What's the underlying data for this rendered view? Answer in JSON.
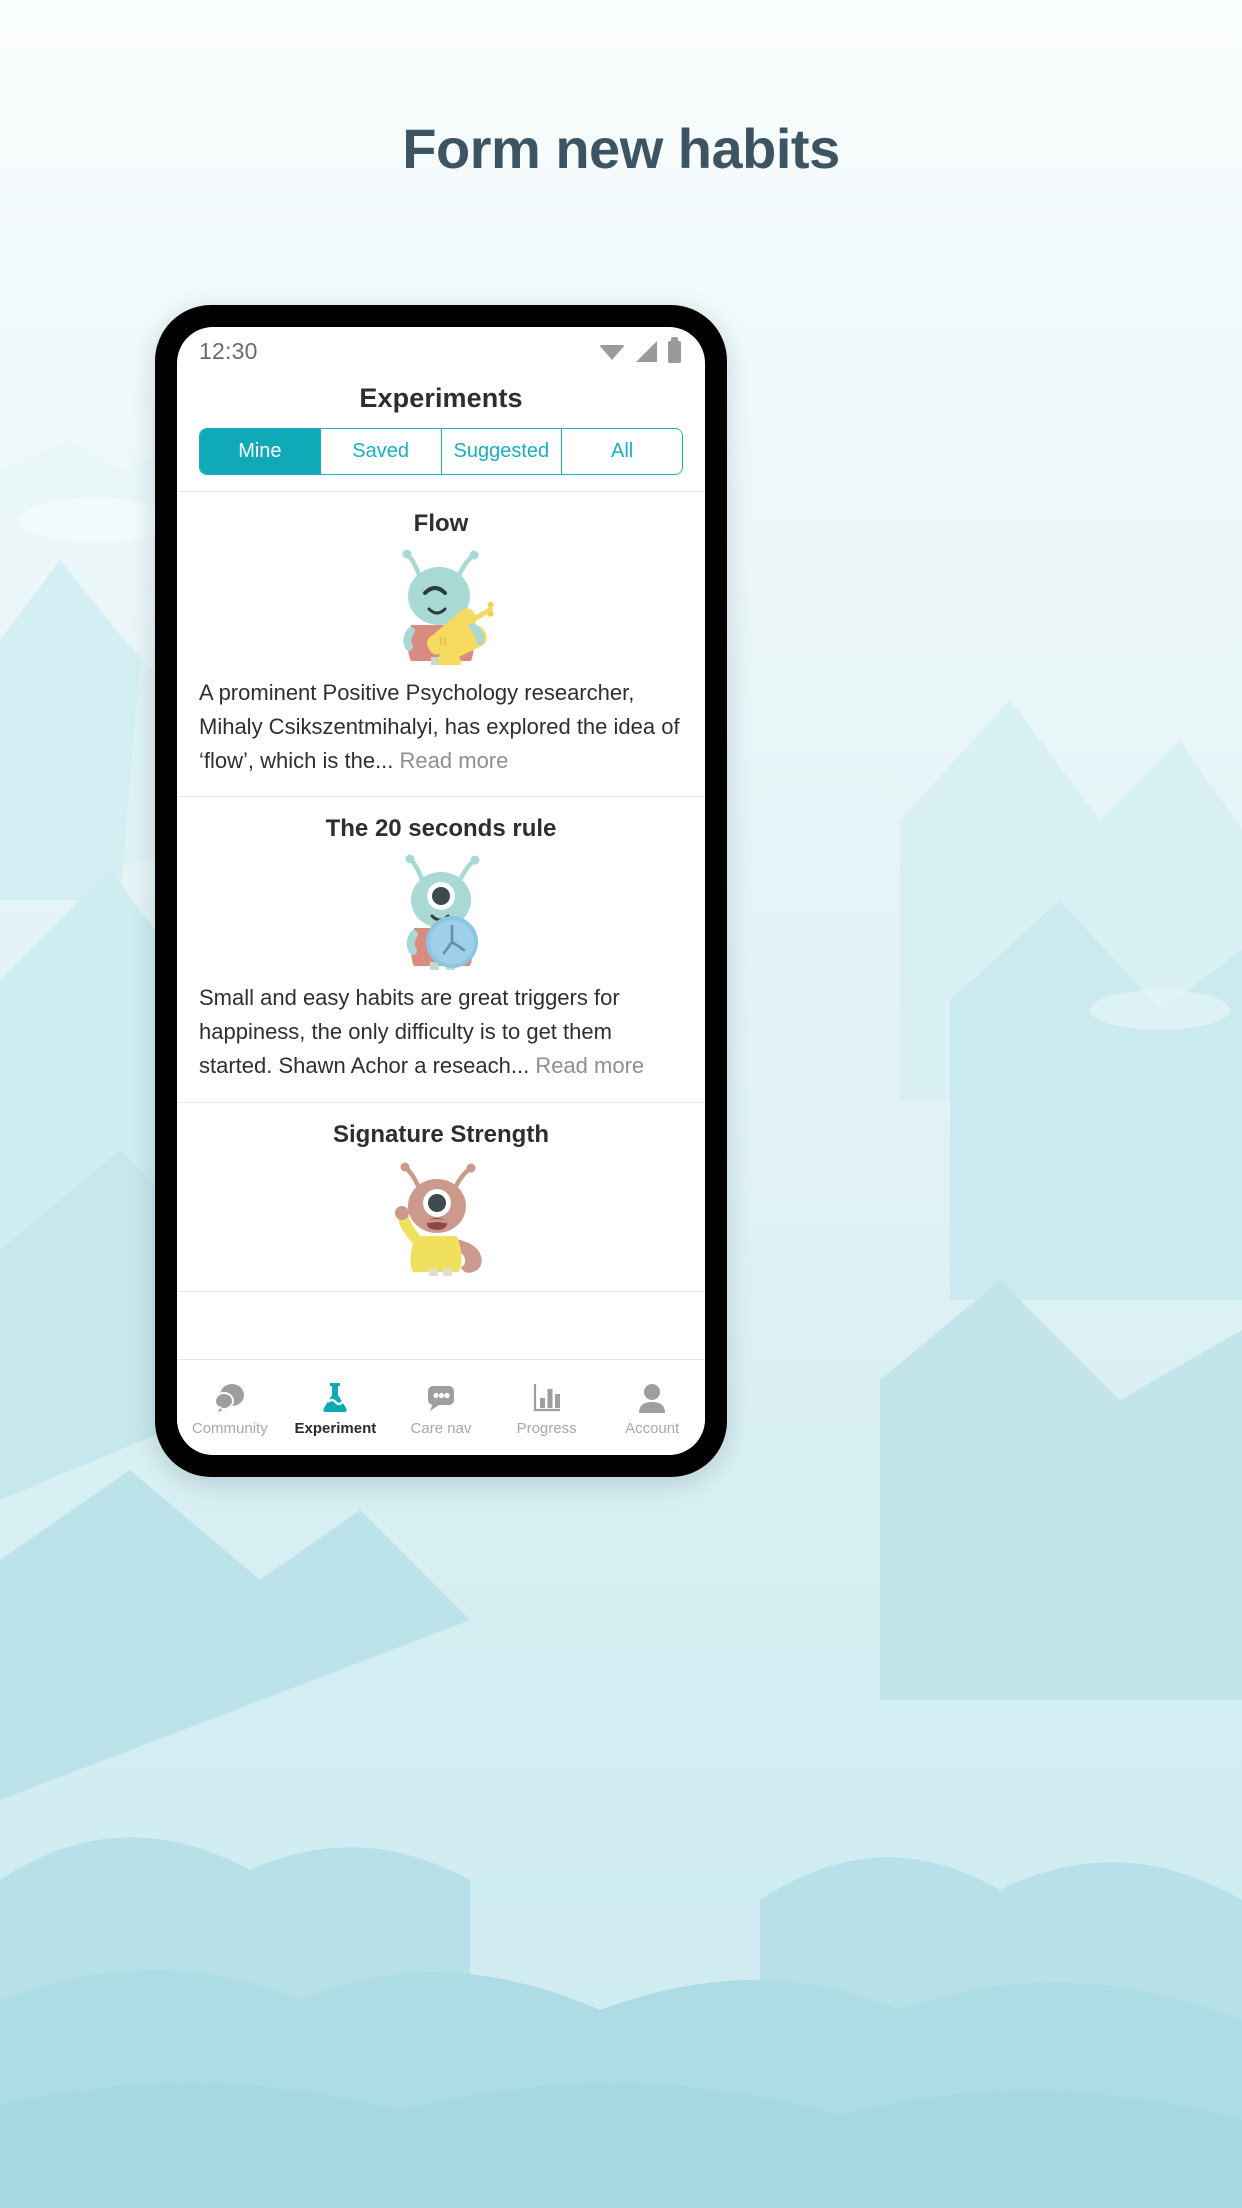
{
  "page": {
    "title": "Form new habits",
    "title_color": "#3d5562",
    "bg_top": "#fbfdfd",
    "bg_bottom": "#cdebf0"
  },
  "status_bar": {
    "time": "12:30",
    "icons": [
      "wifi-icon",
      "signal-icon",
      "battery-icon"
    ]
  },
  "app": {
    "header_title": "Experiments",
    "accent": "#0fa9b8"
  },
  "segmented": {
    "tabs": [
      {
        "label": "Mine",
        "active": true
      },
      {
        "label": "Saved",
        "active": false
      },
      {
        "label": "Suggested",
        "active": false
      },
      {
        "label": "All",
        "active": false
      }
    ]
  },
  "cards": [
    {
      "title": "Flow",
      "art": "alien-playing-violin-illustration",
      "body": "A prominent Positive Psychology researcher, Mihaly Csikszentmihalyi, has explored the idea of ‘flow’, which is the...",
      "read_more": "Read more"
    },
    {
      "title": "The 20 seconds rule",
      "art": "alien-holding-clock-illustration",
      "body": "Small and easy habits are great triggers for happiness, the only difficulty is to get them started. Shawn Achor a reseach...",
      "read_more": "Read more"
    },
    {
      "title": "Signature Strength",
      "art": "yellow-creature-waving-illustration",
      "body": "",
      "read_more": ""
    }
  ],
  "bottom_nav": {
    "items": [
      {
        "label": "Community",
        "icon": "speech-bubbles-icon",
        "active": false
      },
      {
        "label": "Experiment",
        "icon": "flask-icon",
        "active": true
      },
      {
        "label": "Care nav",
        "icon": "chat-dots-icon",
        "active": false
      },
      {
        "label": "Progress",
        "icon": "bar-chart-icon",
        "active": false
      },
      {
        "label": "Account",
        "icon": "person-icon",
        "active": false
      }
    ]
  }
}
